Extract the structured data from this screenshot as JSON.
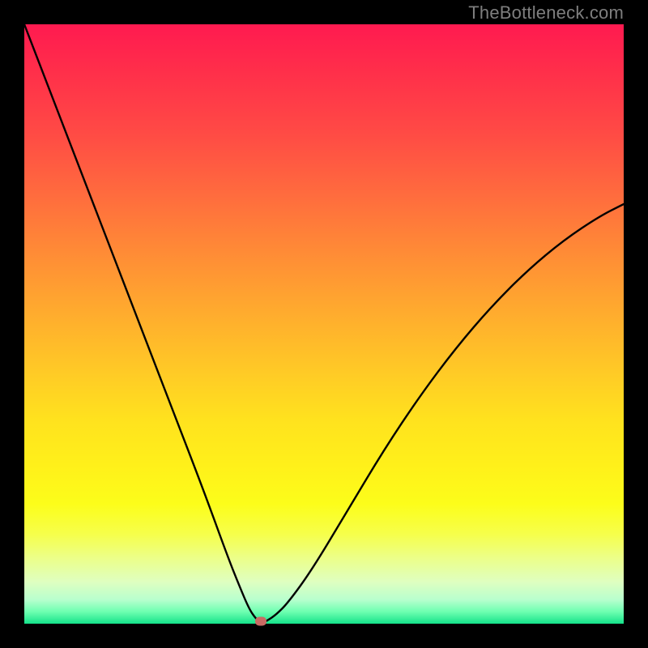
{
  "watermark": {
    "text": "TheBottleneck.com"
  },
  "chart_data": {
    "type": "line",
    "title": "",
    "xlabel": "",
    "ylabel": "",
    "xlim": [
      0,
      100
    ],
    "ylim": [
      0,
      100
    ],
    "grid": false,
    "legend": false,
    "background_gradient": {
      "direction": "vertical",
      "stops": [
        {
          "pos": 0.0,
          "color": "#ff1a50"
        },
        {
          "pos": 0.38,
          "color": "#ff8b36"
        },
        {
          "pos": 0.66,
          "color": "#ffe21e"
        },
        {
          "pos": 0.89,
          "color": "#ecff88"
        },
        {
          "pos": 1.0,
          "color": "#14e28a"
        }
      ]
    },
    "optimum_marker": {
      "x": 39.5,
      "y": 0,
      "color": "#c96a63"
    },
    "series": [
      {
        "name": "bottleneck-curve",
        "x": [
          0,
          5,
          10,
          15,
          20,
          25,
          30,
          34,
          36,
          37.5,
          38.5,
          39.5,
          40.5,
          42,
          44,
          48,
          54,
          60,
          66,
          72,
          78,
          84,
          90,
          96,
          100
        ],
        "values": [
          100,
          87,
          74,
          61,
          48,
          35,
          22,
          11,
          6,
          2.5,
          1.0,
          0,
          0.5,
          1.5,
          3.5,
          9,
          19,
          29,
          38,
          46,
          53,
          59,
          64,
          68,
          70
        ]
      }
    ]
  }
}
